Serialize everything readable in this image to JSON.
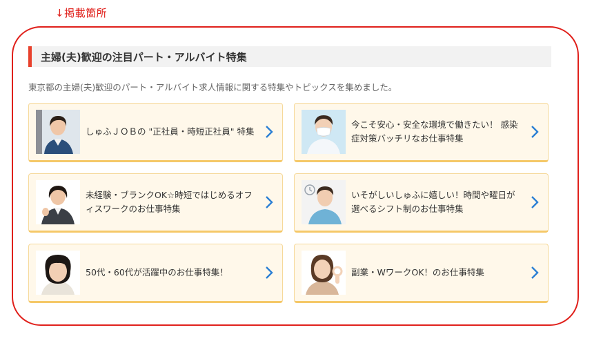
{
  "annotation": {
    "marker_label": "↓掲載箇所",
    "frame_color": "#e0201b"
  },
  "section": {
    "title": "主婦(夫)歓迎の注目パート・アルバイト特集",
    "description": "東京都の主婦(夫)歓迎のパート・アルバイト求人情報に関する特集やトピックスを集めました。",
    "accent_color": "#e8412c"
  },
  "cards": [
    {
      "text": "しゅふＪＯＢの \"正社員・時短正社員\" 特集",
      "icon": "chevron-right-icon"
    },
    {
      "text": "今こそ安心・安全な環境で働きたい！ 感染症対策バッチリなお仕事特集",
      "icon": "chevron-right-icon"
    },
    {
      "text": "未経験・ブランクOK☆時短ではじめるオフィスワークのお仕事特集",
      "icon": "chevron-right-icon"
    },
    {
      "text": "いそがしいしゅふに嬉しい！時間や曜日が選べるシフト制のお仕事特集",
      "icon": "chevron-right-icon"
    },
    {
      "text": "50代・60代が活躍中のお仕事特集！",
      "icon": "chevron-right-icon"
    },
    {
      "text": "副業・WワークOK！のお仕事特集",
      "icon": "chevron-right-icon"
    }
  ],
  "colors": {
    "card_bg": "#fff8ea",
    "card_border": "#f5c868",
    "arrow": "#2a7fd4"
  }
}
